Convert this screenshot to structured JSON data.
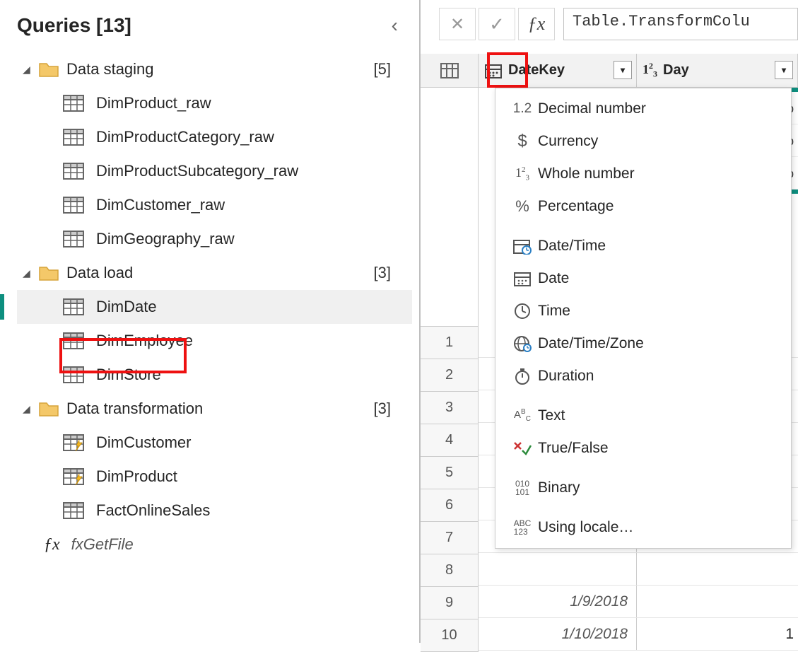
{
  "sidebar": {
    "title": "Queries [13]",
    "groups": [
      {
        "name": "Data staging",
        "count": "[5]",
        "items": [
          {
            "label": "DimProduct_raw"
          },
          {
            "label": "DimProductCategory_raw"
          },
          {
            "label": "DimProductSubcategory_raw"
          },
          {
            "label": "DimCustomer_raw"
          },
          {
            "label": "DimGeography_raw"
          }
        ]
      },
      {
        "name": "Data load",
        "count": "[3]",
        "items": [
          {
            "label": "DimDate",
            "selected": true
          },
          {
            "label": "DimEmployee"
          },
          {
            "label": "DimStore"
          }
        ]
      },
      {
        "name": "Data transformation",
        "count": "[3]",
        "items": [
          {
            "label": "DimCustomer",
            "lightning": true
          },
          {
            "label": "DimProduct",
            "lightning": true
          },
          {
            "label": "FactOnlineSales"
          }
        ]
      }
    ],
    "fx_item": "fxGetFile"
  },
  "formula_bar": {
    "text": "Table.TransformColu"
  },
  "columns": {
    "col1": "DateKey",
    "col2": "Day"
  },
  "type_menu": [
    {
      "icon": "1.2",
      "label": "Decimal number"
    },
    {
      "icon": "$",
      "label": "Currency"
    },
    {
      "icon": "123-sub",
      "label": "Whole number"
    },
    {
      "icon": "%",
      "label": "Percentage"
    },
    {
      "sep": true
    },
    {
      "icon": "datetime",
      "label": "Date/Time",
      "highlighted": true
    },
    {
      "icon": "calendar",
      "label": "Date"
    },
    {
      "icon": "clock",
      "label": "Time"
    },
    {
      "icon": "globe",
      "label": "Date/Time/Zone"
    },
    {
      "icon": "stopwatch",
      "label": "Duration"
    },
    {
      "sep": true
    },
    {
      "icon": "ABC",
      "label": "Text"
    },
    {
      "icon": "xcheck",
      "label": "True/False"
    },
    {
      "sep": true
    },
    {
      "icon": "binary",
      "label": "Binary"
    },
    {
      "sep": true
    },
    {
      "icon": "abc123",
      "label": "Using locale…"
    }
  ],
  "percent_rows": [
    "%",
    "%",
    "%"
  ],
  "row_numbers": [
    "1",
    "2",
    "3",
    "4",
    "5",
    "6",
    "7",
    "8",
    "9",
    "10"
  ],
  "date_rows": [
    "1/9/2018",
    "1/10/2018"
  ],
  "day_trail": "1"
}
